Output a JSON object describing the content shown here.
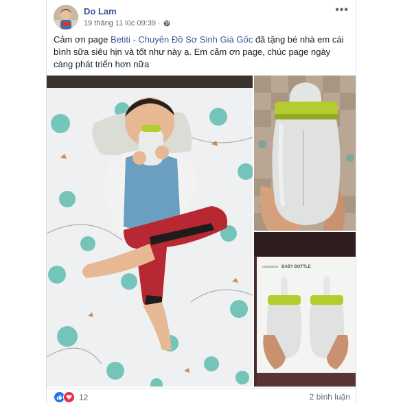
{
  "post": {
    "author": "Do Lam",
    "timestamp": "19 tháng 11 lúc 09:39 ·",
    "privacy_icon": "globe-icon",
    "more_label": "•••",
    "text_before": "Cảm ơn page ",
    "page_link": "Betiti - Chuyên Đồ Sơ Sinh Giá Gốc",
    "text_after": " đã tặng bé nhà em cái bình sữa siêu hịn và tốt như này ạ. Em cảm ơn page, chúc page ngày càng phát triển hơn nữa"
  },
  "photos": {
    "box_brand": "comotomo",
    "box_title": "BABY BOTTLE"
  },
  "footer": {
    "reaction_icons": [
      "like-icon",
      "love-icon"
    ],
    "reaction_count": "12",
    "comments": "2 bình luận"
  },
  "colors": {
    "link": "#385898",
    "like": "#1877f2",
    "love": "#f0284a",
    "bottle_green": "#b5cc2e"
  }
}
